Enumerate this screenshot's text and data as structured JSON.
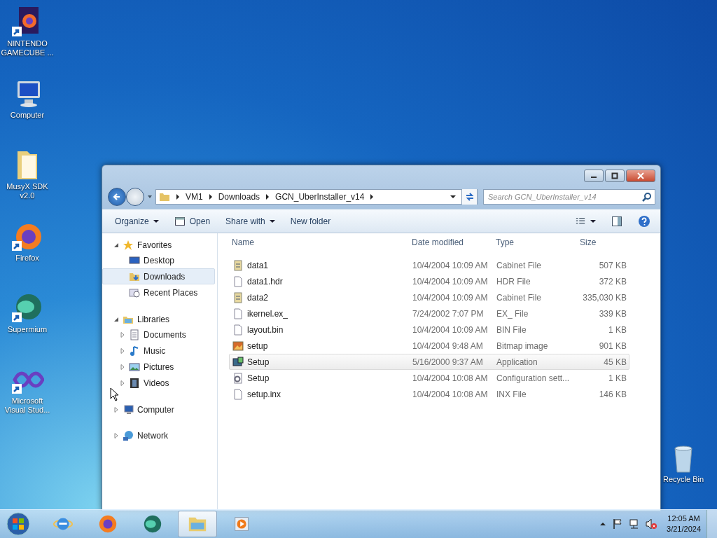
{
  "desktop_icons": [
    {
      "label": "NINTENDO GAMECUBE ...",
      "kind": "firefox-doc",
      "shortcut": true
    },
    {
      "label": "Computer",
      "kind": "computer",
      "shortcut": false
    },
    {
      "label": "MusyX SDK v2.0",
      "kind": "folder",
      "shortcut": false
    },
    {
      "label": "Firefox",
      "kind": "firefox",
      "shortcut": true
    },
    {
      "label": "Supermium",
      "kind": "supermium",
      "shortcut": true
    },
    {
      "label": "Microsoft Visual Stud...",
      "kind": "vs",
      "shortcut": true
    }
  ],
  "recycle_bin": {
    "label": "Recycle Bin"
  },
  "window": {
    "address": [
      "VM1",
      "Downloads",
      "GCN_UberInstaller_v14"
    ],
    "search": {
      "placeholder": "Search GCN_UberInstaller_v14"
    },
    "toolbar": [
      {
        "label": "Organize",
        "kind": "menu"
      },
      {
        "label": "Open",
        "kind": "open"
      },
      {
        "label": "Share with",
        "kind": "menu"
      },
      {
        "label": "New folder",
        "kind": "plain"
      }
    ],
    "nav": [
      {
        "label": "Favorites",
        "kind": "star",
        "expanded": true,
        "children": [
          {
            "label": "Desktop",
            "kind": "desktop",
            "selected": false
          },
          {
            "label": "Downloads",
            "kind": "downloads",
            "selected": true
          },
          {
            "label": "Recent Places",
            "kind": "recent",
            "selected": false
          }
        ]
      },
      {
        "label": "Libraries",
        "kind": "libraries",
        "expanded": true,
        "children": [
          {
            "label": "Documents",
            "kind": "documents",
            "expanded": false
          },
          {
            "label": "Music",
            "kind": "music",
            "expanded": false
          },
          {
            "label": "Pictures",
            "kind": "pictures",
            "expanded": false
          },
          {
            "label": "Videos",
            "kind": "videos",
            "expanded": false
          }
        ]
      },
      {
        "label": "Computer",
        "kind": "computer",
        "expanded": false
      },
      {
        "label": "Network",
        "kind": "network",
        "expanded": false
      }
    ],
    "columns": [
      "Name",
      "Date modified",
      "Type",
      "Size"
    ],
    "files": [
      {
        "name": "data1",
        "date": "10/4/2004 10:09 AM",
        "type": "Cabinet File",
        "size": "507 KB",
        "kind": "cabinet",
        "selected": false
      },
      {
        "name": "data1.hdr",
        "date": "10/4/2004 10:09 AM",
        "type": "HDR File",
        "size": "372 KB",
        "kind": "blank",
        "selected": false
      },
      {
        "name": "data2",
        "date": "10/4/2004 10:09 AM",
        "type": "Cabinet File",
        "size": "335,030 KB",
        "kind": "cabinet",
        "selected": false
      },
      {
        "name": "ikernel.ex_",
        "date": "7/24/2002 7:07 PM",
        "type": "EX_ File",
        "size": "339 KB",
        "kind": "blank",
        "selected": false
      },
      {
        "name": "layout.bin",
        "date": "10/4/2004 10:09 AM",
        "type": "BIN File",
        "size": "1 KB",
        "kind": "blank",
        "selected": false
      },
      {
        "name": "setup",
        "date": "10/4/2004 9:48 AM",
        "type": "Bitmap image",
        "size": "901 KB",
        "kind": "bitmap",
        "selected": false
      },
      {
        "name": "Setup",
        "date": "5/16/2000 9:37 AM",
        "type": "Application",
        "size": "45 KB",
        "kind": "app",
        "selected": true
      },
      {
        "name": "Setup",
        "date": "10/4/2004 10:08 AM",
        "type": "Configuration sett...",
        "size": "1 KB",
        "kind": "config",
        "selected": false
      },
      {
        "name": "setup.inx",
        "date": "10/4/2004 10:08 AM",
        "type": "INX File",
        "size": "146 KB",
        "kind": "blank",
        "selected": false
      }
    ]
  },
  "taskbar": {
    "apps": [
      {
        "kind": "ie",
        "active": false
      },
      {
        "kind": "firefox",
        "active": false
      },
      {
        "kind": "supermium",
        "active": false
      },
      {
        "kind": "explorer",
        "active": true
      },
      {
        "kind": "media",
        "active": false
      }
    ],
    "time": "12:05 AM",
    "date": "3/21/2024"
  }
}
